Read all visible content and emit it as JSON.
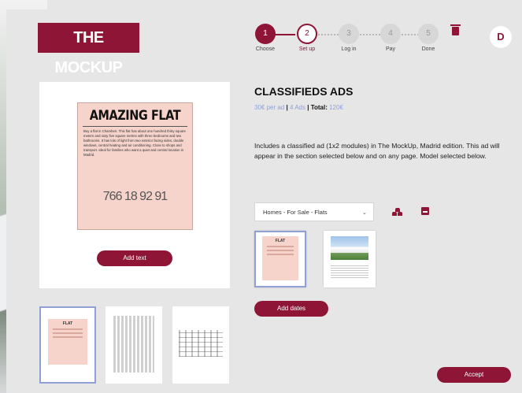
{
  "brand": {
    "logo_text": "THE MOCKUP",
    "accent": "#8e1536"
  },
  "steps": [
    {
      "number": "1",
      "label": "Choose",
      "state": "done"
    },
    {
      "number": "2",
      "label": "Set up",
      "state": "current"
    },
    {
      "number": "3",
      "label": "Log in",
      "state": "todo"
    },
    {
      "number": "4",
      "label": "Pay",
      "state": "todo"
    },
    {
      "number": "5",
      "label": "Done",
      "state": "todo"
    }
  ],
  "header": {
    "avatar_initial": "D"
  },
  "preview": {
    "ad_title": "AMAZING FLAT",
    "ad_body": "Buy a flat in Chamberi. This flat has about one hundred thirty square meters and sixty five square metres with three bedrooms and two bathrooms. It has lots of light from two exterior facing sides, double windows, central heating and air conditioning. Close to shops and transport. Ideal for families who want a quiet and central location in Madrid.",
    "ad_phone": "766 18 92 91",
    "add_text_label": "Add text"
  },
  "product": {
    "title": "CLASSIFIEDS ADS",
    "price_per_ad": "30€ per ad",
    "ads_count": "4 Ads",
    "total_label": "Total:",
    "total_value": "120€",
    "description": "Includes a classified ad (1x2 modules) in The MockUp, Madrid edition. This ad will appear in the section selected below and on any page. Model selected below."
  },
  "section_select": {
    "value": "Homes - For Sale - Flats"
  },
  "models": [
    {
      "title": "FLAT"
    },
    {
      "title": ""
    }
  ],
  "add_dates_label": "Add dates",
  "accept_label": "Accept",
  "thumb_ad_title": "FLAT"
}
